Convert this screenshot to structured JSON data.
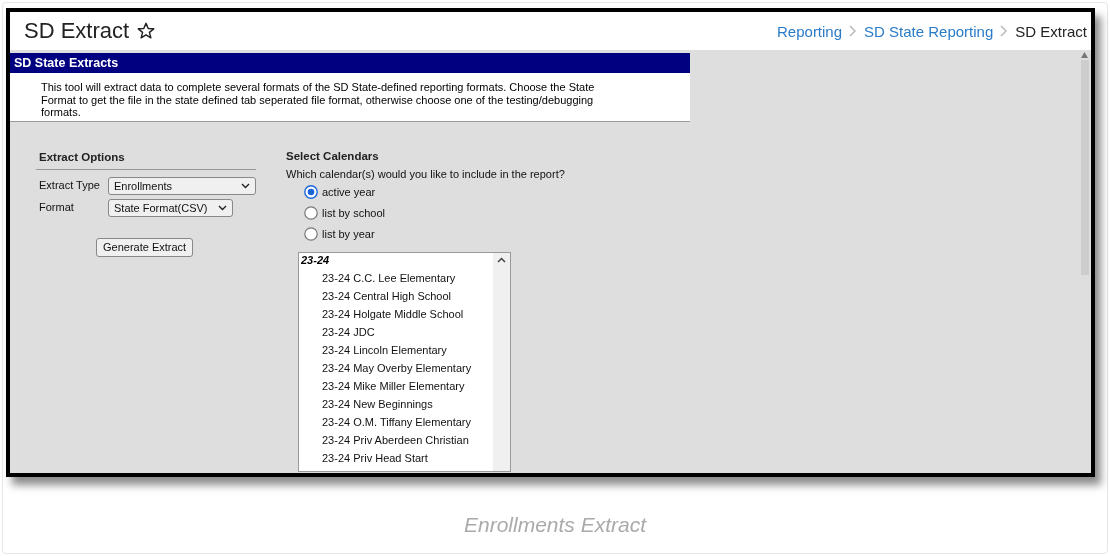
{
  "page": {
    "title": "SD Extract",
    "favorite": false,
    "breadcrumbs": [
      {
        "label": "Reporting",
        "current": false
      },
      {
        "label": "SD State Reporting",
        "current": false
      },
      {
        "label": "SD Extract",
        "current": true
      }
    ]
  },
  "panel": {
    "title": "SD State Extracts",
    "description": "This tool will extract data to complete several formats of the SD State-defined reporting formats. Choose the State Format to get the file in the state defined tab seperated file format, otherwise choose one of the testing/debugging formats."
  },
  "extract_options": {
    "heading": "Extract Options",
    "fields": [
      {
        "label": "Extract Type",
        "value": "Enrollments"
      },
      {
        "label": "Format",
        "value": "State Format(CSV)"
      }
    ],
    "button": "Generate Extract"
  },
  "calendars": {
    "heading": "Select Calendars",
    "question": "Which calendar(s) would you like to include in the report?",
    "options": [
      {
        "label": "active year",
        "selected": true
      },
      {
        "label": "list by school",
        "selected": false
      },
      {
        "label": "list by year",
        "selected": false
      }
    ],
    "list": {
      "group": "23-24",
      "items": [
        "23-24 C.C. Lee Elementary",
        "23-24 Central High School",
        "23-24 Holgate Middle School",
        "23-24 JDC",
        "23-24 Lincoln Elementary",
        "23-24 May Overby Elementary",
        "23-24 Mike Miller Elementary",
        "23-24 New Beginnings",
        "23-24 O.M. Tiffany Elementary",
        "23-24 Priv Aberdeen Christian",
        "23-24 Priv Head Start"
      ]
    }
  },
  "caption": "Enrollments Extract"
}
